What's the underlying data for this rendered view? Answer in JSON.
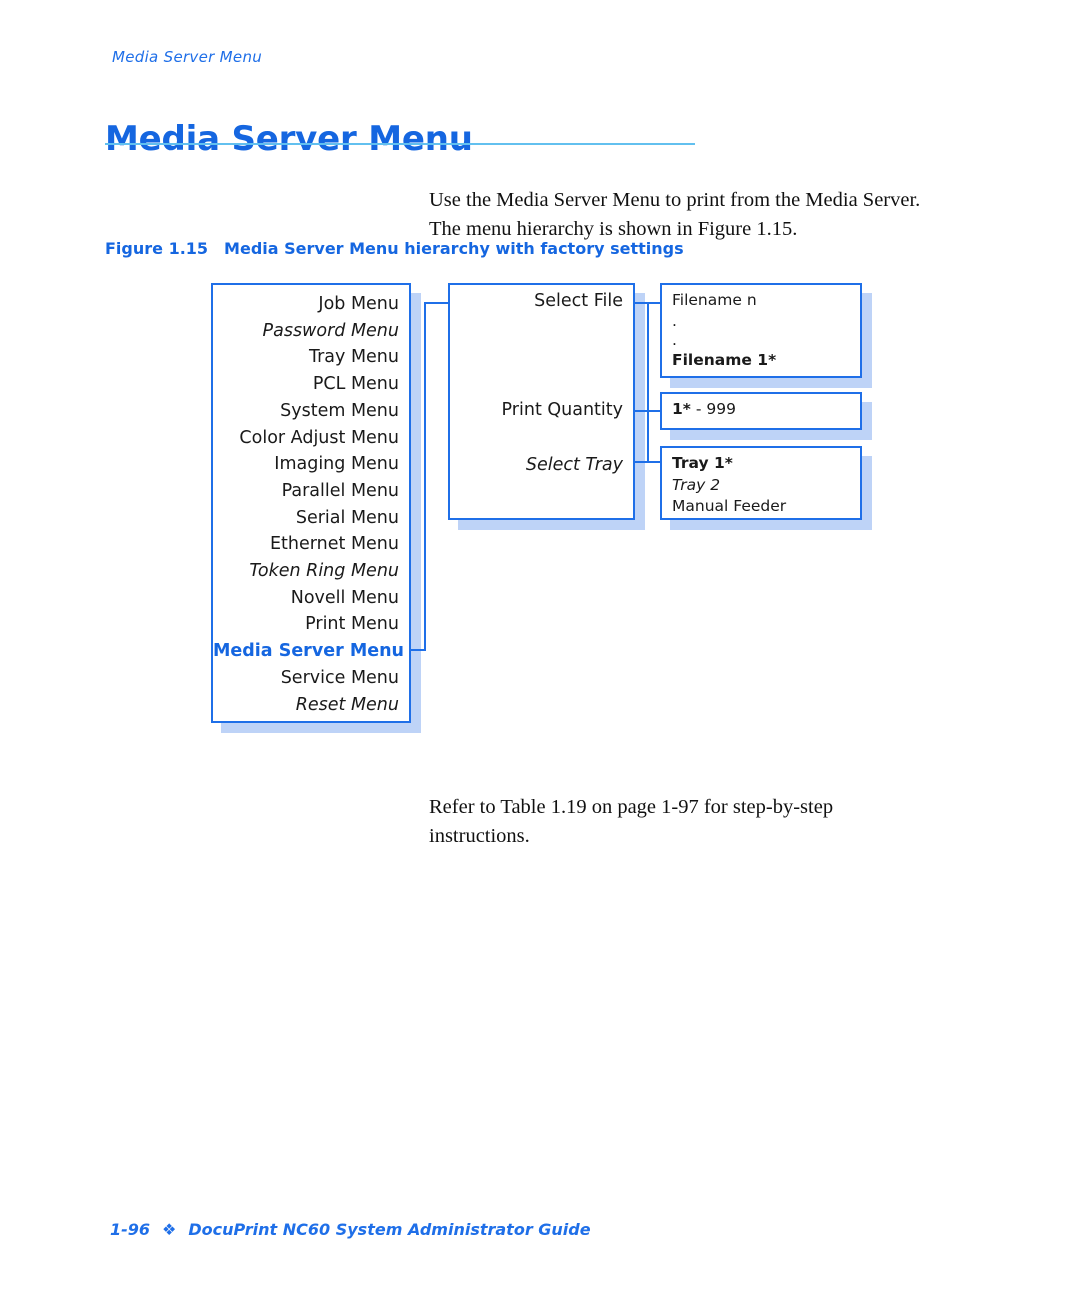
{
  "running_head": "Media Server Menu",
  "page_title": "Media Server Menu",
  "intro_paragraph": "Use the Media Server Menu to print from the Media Server. The menu hierarchy is shown in Figure 1.15.",
  "figure": {
    "caption_number": "Figure 1.15",
    "caption_text": "Media Server Menu hierarchy with factory settings",
    "main_menu": {
      "items": [
        {
          "label": "Job Menu",
          "style": "normal"
        },
        {
          "label": "Password Menu",
          "style": "italic"
        },
        {
          "label": "Tray Menu",
          "style": "normal"
        },
        {
          "label": "PCL Menu",
          "style": "normal"
        },
        {
          "label": "System Menu",
          "style": "normal"
        },
        {
          "label": "Color Adjust Menu",
          "style": "normal"
        },
        {
          "label": "Imaging Menu",
          "style": "normal"
        },
        {
          "label": "Parallel Menu",
          "style": "normal"
        },
        {
          "label": "Serial Menu",
          "style": "normal"
        },
        {
          "label": "Ethernet Menu",
          "style": "normal"
        },
        {
          "label": "Token Ring Menu",
          "style": "italic"
        },
        {
          "label": "Novell Menu",
          "style": "normal"
        },
        {
          "label": "Print Menu",
          "style": "normal"
        },
        {
          "label": "Media Server Menu",
          "style": "highlight"
        },
        {
          "label": "Service Menu",
          "style": "normal"
        },
        {
          "label": "Reset Menu",
          "style": "italic"
        }
      ]
    },
    "media_server_options": {
      "select_file": "Select File",
      "print_quantity": "Print Quantity",
      "select_tray": "Select Tray"
    },
    "filenames": {
      "items": [
        {
          "label": "Filename n",
          "style": "normal"
        },
        {
          "label": ".",
          "style": "dot"
        },
        {
          "label": ".",
          "style": "dot"
        },
        {
          "label": "Filename 1*",
          "style": "bold"
        }
      ]
    },
    "quantity": {
      "default_value": "1*",
      "range_suffix": "- 999"
    },
    "trays": {
      "items": [
        {
          "label": "Tray 1*",
          "style": "bold"
        },
        {
          "label": "Tray 2",
          "style": "italic"
        },
        {
          "label": "Manual Feeder",
          "style": "normal"
        }
      ]
    }
  },
  "outro_paragraph": "Refer to Table 1.19 on page 1-97 for step-by-step instructions.",
  "footer": {
    "page_number": "1-96",
    "bullet": "❖",
    "guide_title": "DocuPrint NC60 System Administrator Guide"
  },
  "colors": {
    "accent_blue": "#1f6fe8",
    "title_blue": "#1566e0",
    "rule_blue": "#62c0ef",
    "shadow_blue": "#bed3f7"
  }
}
